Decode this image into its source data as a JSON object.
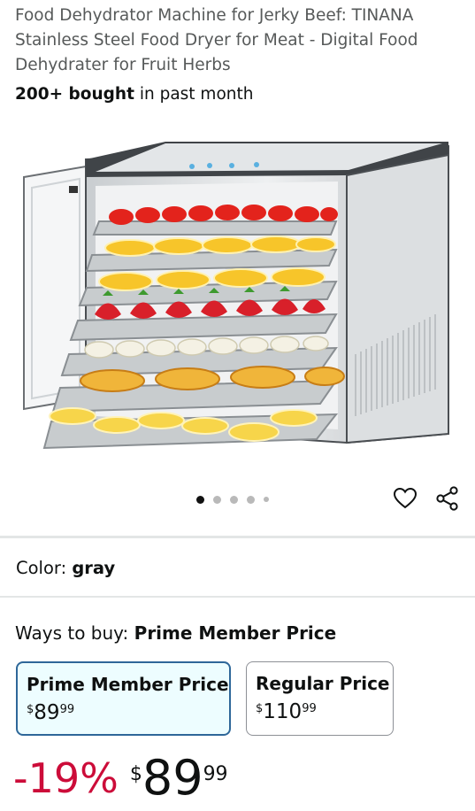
{
  "product": {
    "title": "Food Dehydrator Machine for Jerky Beef: TINANA Stainless Steel Food Dryer for Meat - Digital Food Dehydrater for Fruit Herbs",
    "bought_bold": "200+ bought",
    "bought_rest": " in past month"
  },
  "gallery": {
    "total_dots": 5,
    "active_index": 0
  },
  "color": {
    "label": "Color: ",
    "value": "gray"
  },
  "ways_to_buy": {
    "label": "Ways to buy: ",
    "selected": "Prime Member Price",
    "options": [
      {
        "title": "Prime Member Price",
        "symbol": "$",
        "whole": "89",
        "cents": "99"
      },
      {
        "title": "Regular Price",
        "symbol": "$",
        "whole": "110",
        "cents": "99"
      }
    ]
  },
  "price": {
    "discount": "-19%",
    "symbol": "$",
    "whole": "89",
    "cents": "99"
  },
  "colors": {
    "accent_border": "#2e6799",
    "selected_bg": "#edfdff",
    "discount": "#cc0c39"
  },
  "icons": [
    "heart-icon",
    "share-icon"
  ]
}
